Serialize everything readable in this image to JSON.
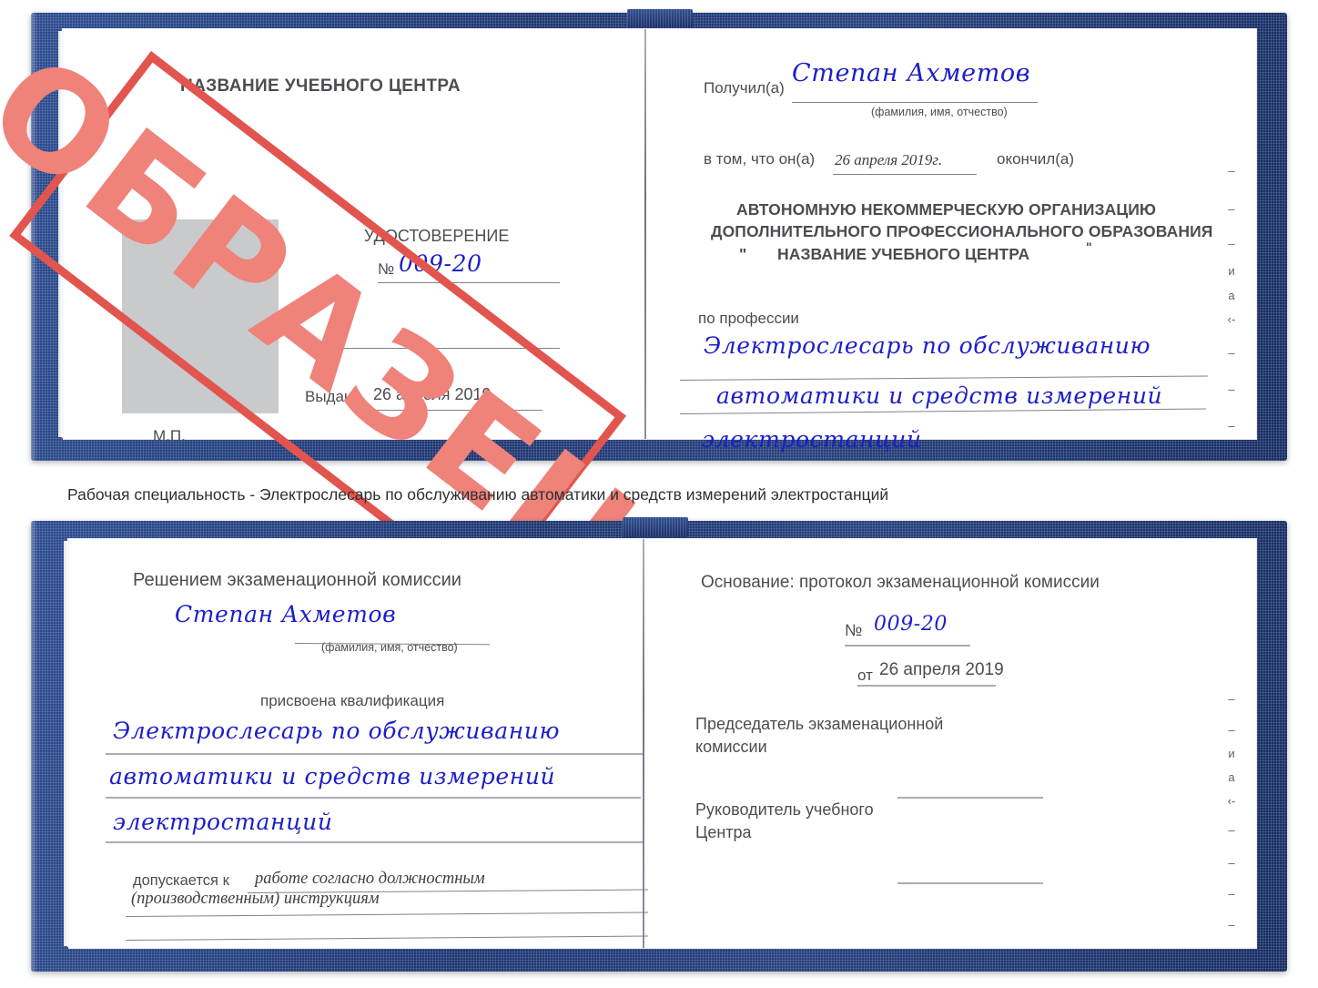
{
  "caption": "Рабочая специальность - Электрослесарь по обслуживанию автоматики и средств измерений электростанций",
  "stamp": {
    "text": "ОБРАЗЕЦ",
    "color": "#e2554f",
    "fill_color": "#ef8279"
  },
  "colors": {
    "cover_navy": "#203a78",
    "ink_blue": "#1d1ec9",
    "page_white": "#ffffff",
    "photo_gray": "#c9cacc",
    "rule_gray": "#7d828b"
  },
  "certificate_top": {
    "left_page": {
      "center_name": "НАЗВАНИЕ УЧЕБНОГО ЦЕНТРА",
      "doc_title": "УДОСТОВЕРЕНИЕ",
      "number_label": "№",
      "number_value": "009-20",
      "issued_label": "Выдано",
      "issued_date": "26 апреля 2019",
      "seal_label": "М.П.",
      "photo_placeholder": "photo-box"
    },
    "right_page": {
      "received_label": "Получил(а)",
      "received_name": "Степан Ахметов",
      "name_hint": "(фамилия, имя, отчество)",
      "that_he_label": "в том, что он(а)",
      "completion_date": "26 апреля 2019г.",
      "finished_label": "окончил(а)",
      "org_line1": "АВТОНОМНУЮ НЕКОММЕРЧЕСКУЮ ОРГАНИЗАЦИЮ",
      "org_line2": "ДОПОЛНИТЕЛЬНОГО ПРОФЕССИОНАЛЬНОГО ОБРАЗОВАНИЯ",
      "org_quote_open": "\"",
      "org_line3": "НАЗВАНИЕ УЧЕБНОГО ЦЕНТРА",
      "org_quote_close": "\"",
      "profession_label": "по профессии",
      "profession_line1": "Электрослесарь по обслуживанию",
      "profession_line2": "автоматики и средств измерений",
      "profession_line3": "электростанций",
      "edge_marks": [
        "–",
        "–",
        "–",
        "и",
        "а",
        "‹-",
        "–",
        "–",
        "–"
      ]
    }
  },
  "certificate_bottom": {
    "left_page": {
      "decision_label": "Решением экзаменационной комиссии",
      "name": "Степан Ахметов",
      "name_hint": "(фамилия, имя, отчество)",
      "qualification_label": "присвоена квалификация",
      "qualification_line1": "Электрослесарь по обслуживанию",
      "qualification_line2": "автоматики и средств измерений",
      "qualification_line3": "электростанций",
      "allowed_label": "допускается к",
      "allowed_line1": "работе согласно должностным",
      "allowed_line2": "(производственным) инструкциям"
    },
    "right_page": {
      "basis_label": "Основание: протокол экзаменационной комиссии",
      "number_label": "№",
      "number_value": "009-20",
      "date_label": "от",
      "date_value": "26 апреля 2019",
      "chairman_line1": "Председатель экзаменационной",
      "chairman_line2": "комиссии",
      "head_line1": "Руководитель учебного",
      "head_line2": "Центра",
      "edge_marks": [
        "–",
        "–",
        "и",
        "а",
        "‹-",
        "–",
        "–",
        "–",
        "–"
      ]
    }
  }
}
